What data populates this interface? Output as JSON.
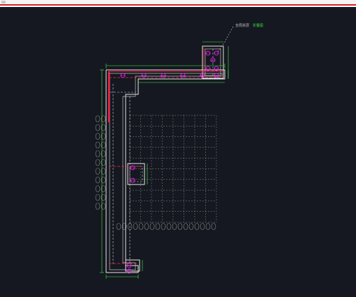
{
  "window": {
    "accent_color": "#d62020",
    "canvas_color": "#151820"
  },
  "annotation": {
    "label_text": "全局拆层",
    "label_link": "折叠图",
    "text_color": "#c0c0c0",
    "link_color": "#33dd33"
  },
  "drawing": {
    "line_color": "#d8d8d8",
    "dim_color": "#44ee44",
    "wall_color": "#ffffff",
    "rebar_color": "#ff2244",
    "stirrup_color": "#ff22ff",
    "grid_color": "#8a8a8a"
  }
}
